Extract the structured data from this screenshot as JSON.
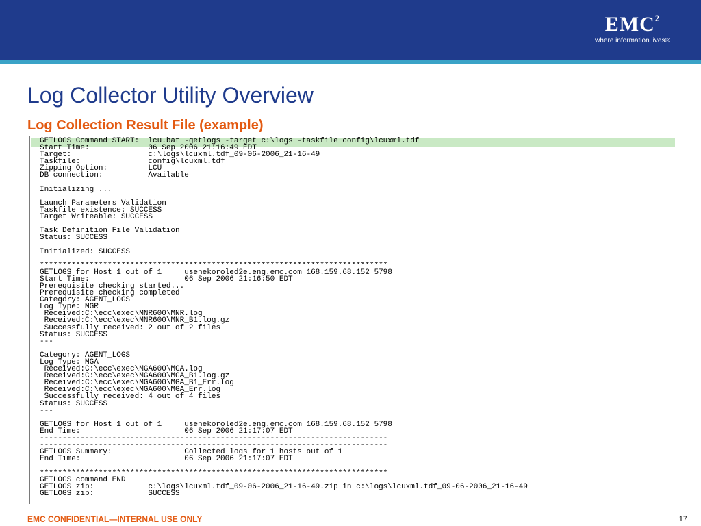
{
  "header": {
    "logo_text": "EMC",
    "logo_superscript": "2",
    "logo_tagline": "where information lives®"
  },
  "slide": {
    "title": "Log Collector Utility Overview",
    "subtitle": "Log Collection Result File (example)"
  },
  "log_lines": [
    "GETLOGS Command START:  lcu.bat -getlogs -target c:\\logs -taskfile config\\lcuxml.tdf",
    "Start Time:             06 Sep 2006 21:16:49 EDT",
    "Target:                 c:\\logs\\lcuxml.tdf_09-06-2006_21-16-49",
    "Taskfile:               config\\lcuxml.tdf",
    "Zipping Option:         LCU",
    "DB connection:          Available",
    "",
    "Initializing ...",
    "",
    "Launch Parameters Validation",
    "Taskfile existence: SUCCESS",
    "Target Writeable: SUCCESS",
    "",
    "Task Definition File Validation",
    "Status: SUCCESS",
    "",
    "Initialized: SUCCESS",
    "",
    "*****************************************************************************",
    "GETLOGS for Host 1 out of 1     usenekoroled2e.eng.emc.com 168.159.68.152 5798",
    "Start Time:                     06 Sep 2006 21:16:50 EDT",
    "Prerequisite checking started...",
    "Prerequisite checking completed",
    "Category: AGENT_LOGS",
    "Log Type: MGR",
    " Received:C:\\ecc\\exec\\MNR600\\MNR.log",
    " Received:C:\\ecc\\exec\\MNR600\\MNR_B1.log.gz",
    " Successfully received: 2 out of 2 files",
    "Status: SUCCESS",
    "---",
    "",
    "Category: AGENT_LOGS",
    "Log Type: MGA",
    " Received:C:\\ecc\\exec\\MGA600\\MGA.log",
    " Received:C:\\ecc\\exec\\MGA600\\MGA_B1.log.gz",
    " Received:C:\\ecc\\exec\\MGA600\\MGA_B1_Err.log",
    " Received:C:\\ecc\\exec\\MGA600\\MGA_Err.log",
    " Successfully received: 4 out of 4 files",
    "Status: SUCCESS",
    "---",
    "",
    "GETLOGS for Host 1 out of 1     usenekoroled2e.eng.emc.com 168.159.68.152 5798",
    "End Time:                       06 Sep 2006 21:17:07 EDT",
    "-----------------------------------------------------------------------------",
    "-----------------------------------------------------------------------------",
    "GETLOGS Summary:                Collected logs for 1 hosts out of 1",
    "End Time:                       06 Sep 2006 21:17:07 EDT",
    "",
    "*****************************************************************************",
    "GETLOGS command END",
    "GETLOGS zip:            c:\\logs\\lcuxml.tdf_09-06-2006_21-16-49.zip in c:\\logs\\lcuxml.tdf_09-06-2006_21-16-49",
    "GETLOGS zip:            SUCCESS"
  ],
  "footer": {
    "confidential": "EMC CONFIDENTIAL—INTERNAL USE ONLY",
    "page_number": "17"
  },
  "colors": {
    "header_blue": "#1f3b8c",
    "accent_cyan": "#3aa3c7",
    "subtitle_orange": "#e35a12",
    "highlight_green": "#c9e9c4"
  }
}
